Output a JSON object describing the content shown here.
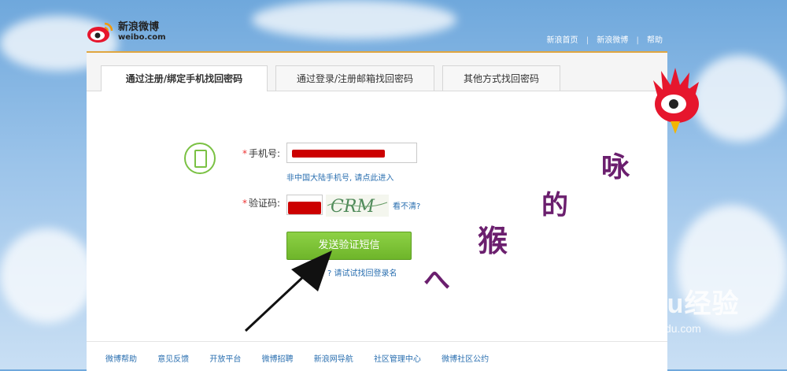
{
  "logo": {
    "cn": "新浪微博",
    "en": "weibo.com"
  },
  "top_links": [
    "新浪首页",
    "新浪微博",
    "帮助"
  ],
  "top_links_sep": "|",
  "tabs": [
    {
      "label": "通过注册/绑定手机找回密码",
      "active": true
    },
    {
      "label": "通过登录/注册邮箱找回密码",
      "active": false
    },
    {
      "label": "其他方式找回密码",
      "active": false
    }
  ],
  "form": {
    "required_mark": "*",
    "phone_label": "手机号:",
    "phone_hint": "非中国大陆手机号, 请点此进入",
    "captcha_label": "验证码:",
    "captcha_text": "CRM",
    "captcha_refresh": "看不清?",
    "send_button": "发送验证短信",
    "recover_link": "? 请试试找回登录名"
  },
  "footer": {
    "links": [
      "微博帮助",
      "意见反馈",
      "开放平台",
      "微博招聘",
      "新浪网导航",
      "社区管理中心",
      "微博社区公约"
    ]
  },
  "overlay": {
    "chars": [
      "的",
      "咏",
      "猴",
      "へ"
    ],
    "watermark_big": "Baidu经验",
    "watermark_small": "jingyan.baidu.com"
  },
  "colors": {
    "accent_green": "#7ac143",
    "link_blue": "#2a6fb0",
    "redaction": "#cc0000",
    "brand_gold": "#e0a640"
  }
}
